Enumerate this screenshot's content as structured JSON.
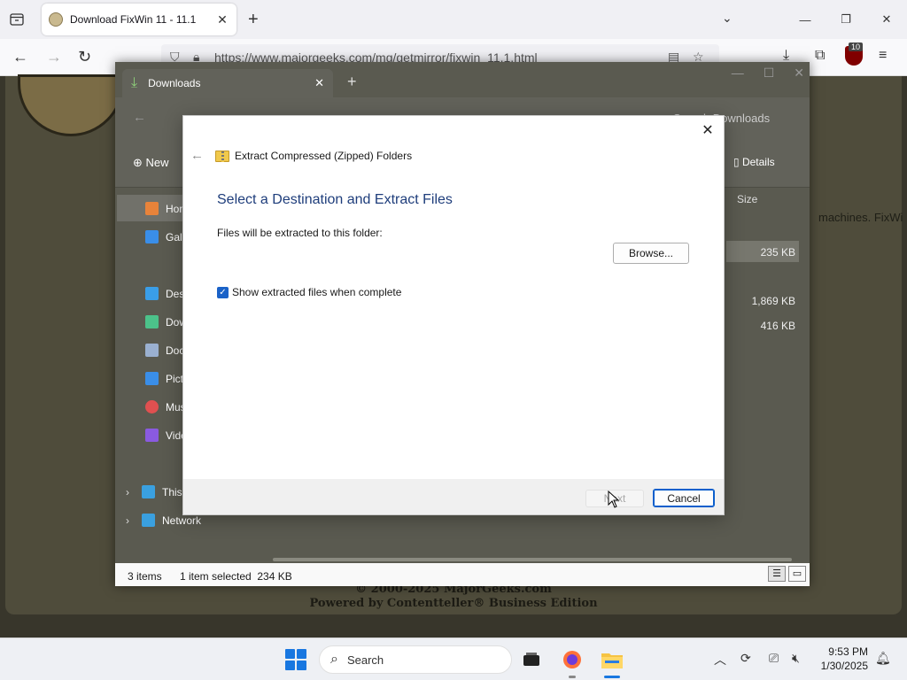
{
  "browser": {
    "tab_title": "Download FixWin 11 - 11.1",
    "url": "https://www.majorgeeks.com/mg/getmirror/fixwin_11.1.html",
    "extension_badge": "10"
  },
  "webpage": {
    "snippet_right": "machines. FixWi",
    "footer_line1": "© 2000-2025 MajorGeeks.com",
    "footer_line2": "Powered by Contentteller® Business Edition"
  },
  "explorer": {
    "tab_title": "Downloads",
    "search_placeholder": "Search Downloads",
    "new_label": "New",
    "details_label": "Details",
    "column_size": "Size",
    "sidebar": [
      {
        "label": "Home",
        "color": "#e8833a"
      },
      {
        "label": "Gallery",
        "color": "#3a8ee8"
      },
      {
        "label": "Desktop",
        "color": "#3a9ee8"
      },
      {
        "label": "Downloads",
        "color": "#4cc28a"
      },
      {
        "label": "Documents",
        "color": "#9ab0d0"
      },
      {
        "label": "Pictures",
        "color": "#3a8ee8"
      },
      {
        "label": "Music",
        "color": "#e05050"
      },
      {
        "label": "Videos",
        "color": "#8a5ae0"
      },
      {
        "label": "This PC",
        "color": "#3aa0e0"
      },
      {
        "label": "Network",
        "color": "#3aa0e0"
      }
    ],
    "sizes": [
      "235 KB",
      "1,869 KB",
      "416 KB"
    ],
    "status": {
      "items": "3 items",
      "selected": "1 item selected  234 KB"
    }
  },
  "dialog": {
    "header": "Extract Compressed (Zipped) Folders",
    "title": "Select a Destination and Extract Files",
    "folder_label": "Files will be extracted to this folder:",
    "browse_label": "Browse...",
    "checkbox_label": "Show extracted files when complete",
    "checkbox_checked": true,
    "next_label": "Next",
    "cancel_label": "Cancel"
  },
  "taskbar": {
    "search_placeholder": "Search",
    "time": "9:53 PM",
    "date": "1/30/2025"
  }
}
